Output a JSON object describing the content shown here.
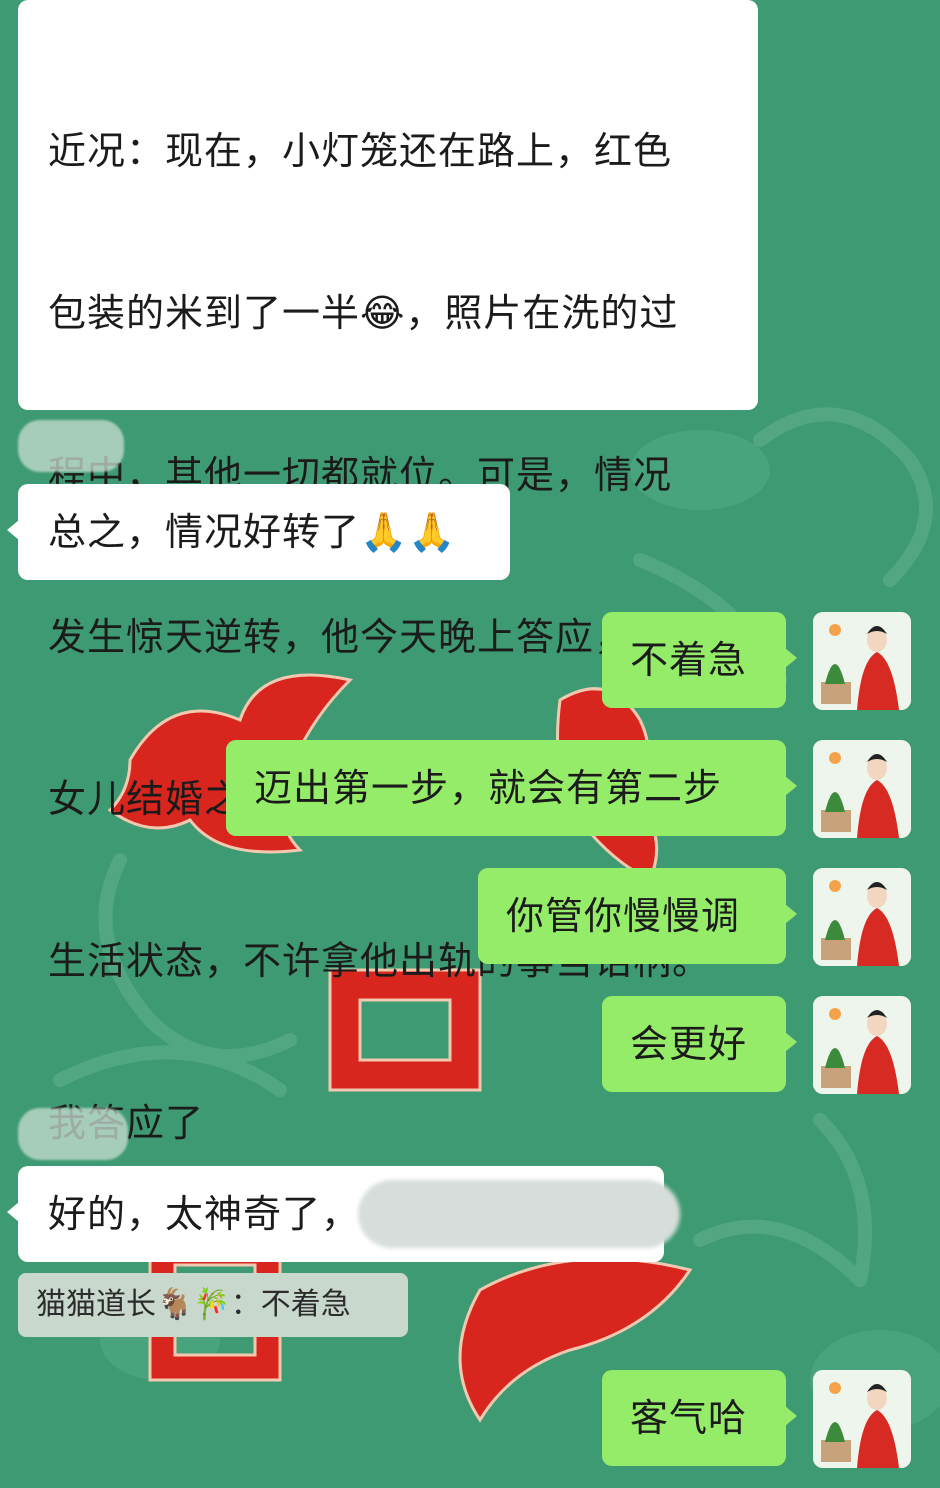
{
  "messages": {
    "m1": {
      "lines": [
        "近况：现在，小灯笼还在路上，红色",
        "包装的米到了一半😂，照片在洗的过",
        "程中，其他一切都就位。可是，情况",
        "发生惊天逆转，他今天晚上答应，在",
        "女儿结婚之前，先不离，维持之前的",
        "生活状态，不许拿他出轨的事当话柄。",
        "我答应了"
      ]
    },
    "m2": {
      "text": "总之，情况好转了🙏🙏"
    },
    "m3": {
      "text": "不着急"
    },
    "m4": {
      "text": "迈出第一步，就会有第二步"
    },
    "m5": {
      "text": "你管你慢慢调"
    },
    "m6": {
      "text": "会更好"
    },
    "m7": {
      "text": "好的，太神奇了，"
    },
    "quote": {
      "text": "猫猫道长🐐🎋：不着急"
    },
    "m8": {
      "text": "客气哈"
    }
  },
  "colors": {
    "background": "#3e9a72",
    "incoming_bubble": "#ffffff",
    "outgoing_bubble": "#95ec69",
    "decoration_red": "#d8261e"
  },
  "icons": {
    "avatar": "avatar-woman-in-red-with-bonsai"
  }
}
